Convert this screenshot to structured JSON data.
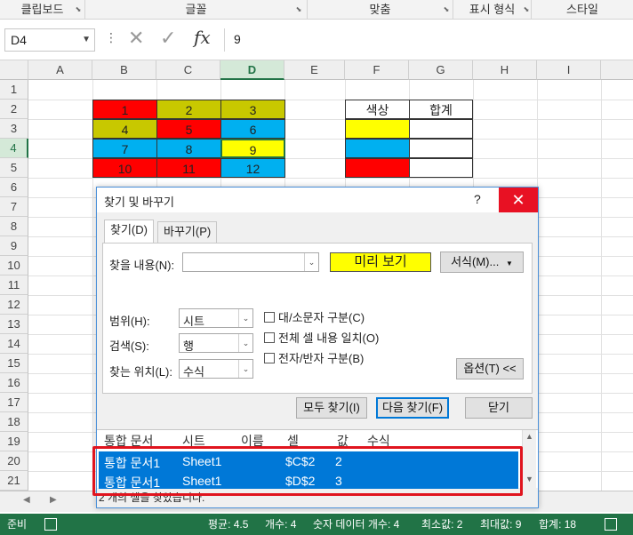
{
  "ribbon": {
    "groups": [
      "클립보드",
      "글꼴",
      "맞춤",
      "표시 형식",
      "스타일"
    ]
  },
  "formula_bar": {
    "name_box": "D4",
    "formula": "9",
    "fx_label": "fx"
  },
  "sheet": {
    "columns": [
      "A",
      "B",
      "C",
      "D",
      "E",
      "F",
      "G",
      "H",
      "I"
    ],
    "rows": [
      "1",
      "2",
      "3",
      "4",
      "5",
      "6",
      "7",
      "8",
      "9",
      "10",
      "11",
      "12",
      "13",
      "14",
      "15",
      "16",
      "17",
      "18",
      "19",
      "20",
      "21"
    ],
    "grid_values": [
      [
        "1",
        "2",
        "3"
      ],
      [
        "4",
        "5",
        "6"
      ],
      [
        "7",
        "8",
        "9"
      ],
      [
        "10",
        "11",
        "12"
      ]
    ],
    "grid_colors": [
      [
        "#ff0000",
        "#c8c800",
        "#c8c800"
      ],
      [
        "#c8c800",
        "#ff0000",
        "#00b0f0"
      ],
      [
        "#00b0f0",
        "#00b0f0",
        "#ffff00"
      ],
      [
        "#ff0000",
        "#ff0000",
        "#00b0f0"
      ]
    ],
    "summary_header_color": "색상",
    "summary_header_total": "합계",
    "summary_colors": [
      "#ffff00",
      "#00b0f0",
      "#ff0000"
    ]
  },
  "dialog": {
    "title": "찾기 및 바꾸기",
    "help": "?",
    "close": "✕",
    "tab_find": "찾기(D)",
    "tab_replace": "바꾸기(P)",
    "find_what_label": "찾을 내용(N):",
    "find_what_value": "",
    "preview_label": "미리 보기",
    "format_button": "서식(M)...",
    "within_label": "범위(H):",
    "within_value": "시트",
    "search_label": "검색(S):",
    "search_value": "행",
    "lookin_label": "찾는 위치(L):",
    "lookin_value": "수식",
    "match_case": "대/소문자 구분(C)",
    "match_entire": "전체 셀 내용 일치(O)",
    "match_byte": "전자/반자 구분(B)",
    "options_button": "옵션(T) <<",
    "find_all_button": "모두 찾기(I)",
    "find_next_button": "다음 찾기(F)",
    "close_button": "닫기",
    "results_headers": [
      "통합 문서",
      "시트",
      "이름",
      "셀",
      "값",
      "수식"
    ],
    "results": [
      {
        "book": "통합 문서1",
        "sheet": "Sheet1",
        "name": "",
        "cell": "$C$2",
        "value": "2",
        "formula": ""
      },
      {
        "book": "통합 문서1",
        "sheet": "Sheet1",
        "name": "",
        "cell": "$D$2",
        "value": "3",
        "formula": ""
      }
    ],
    "status_text": "2 개의 셀을 찾았습니다."
  },
  "status_bar": {
    "ready": "준비",
    "average": "평균: 4.5",
    "count": "개수: 4",
    "numeric_count": "숫자 데이터 개수: 4",
    "min": "최소값: 2",
    "max": "최대값: 9",
    "sum": "합계: 18"
  }
}
